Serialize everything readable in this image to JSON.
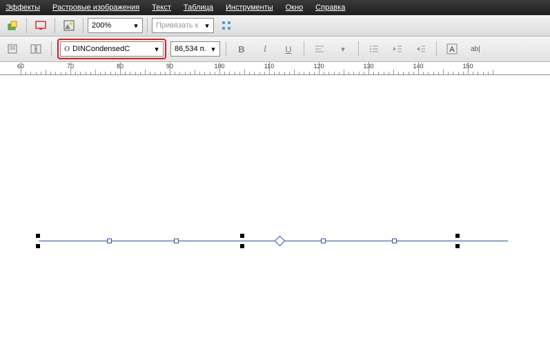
{
  "menu": {
    "effects": "Эффекты",
    "raster": "Растровые изображения",
    "text": "Текст",
    "table": "Таблица",
    "tools": "Инструменты",
    "window": "Окно",
    "help": "Справка"
  },
  "toolbar1": {
    "zoom": "200%",
    "snap": "Привязать к"
  },
  "toolbar2": {
    "font": "DINCondensedC",
    "size": "86,534 п."
  },
  "ruler": {
    "start": 60,
    "end": 155,
    "step": 10
  }
}
